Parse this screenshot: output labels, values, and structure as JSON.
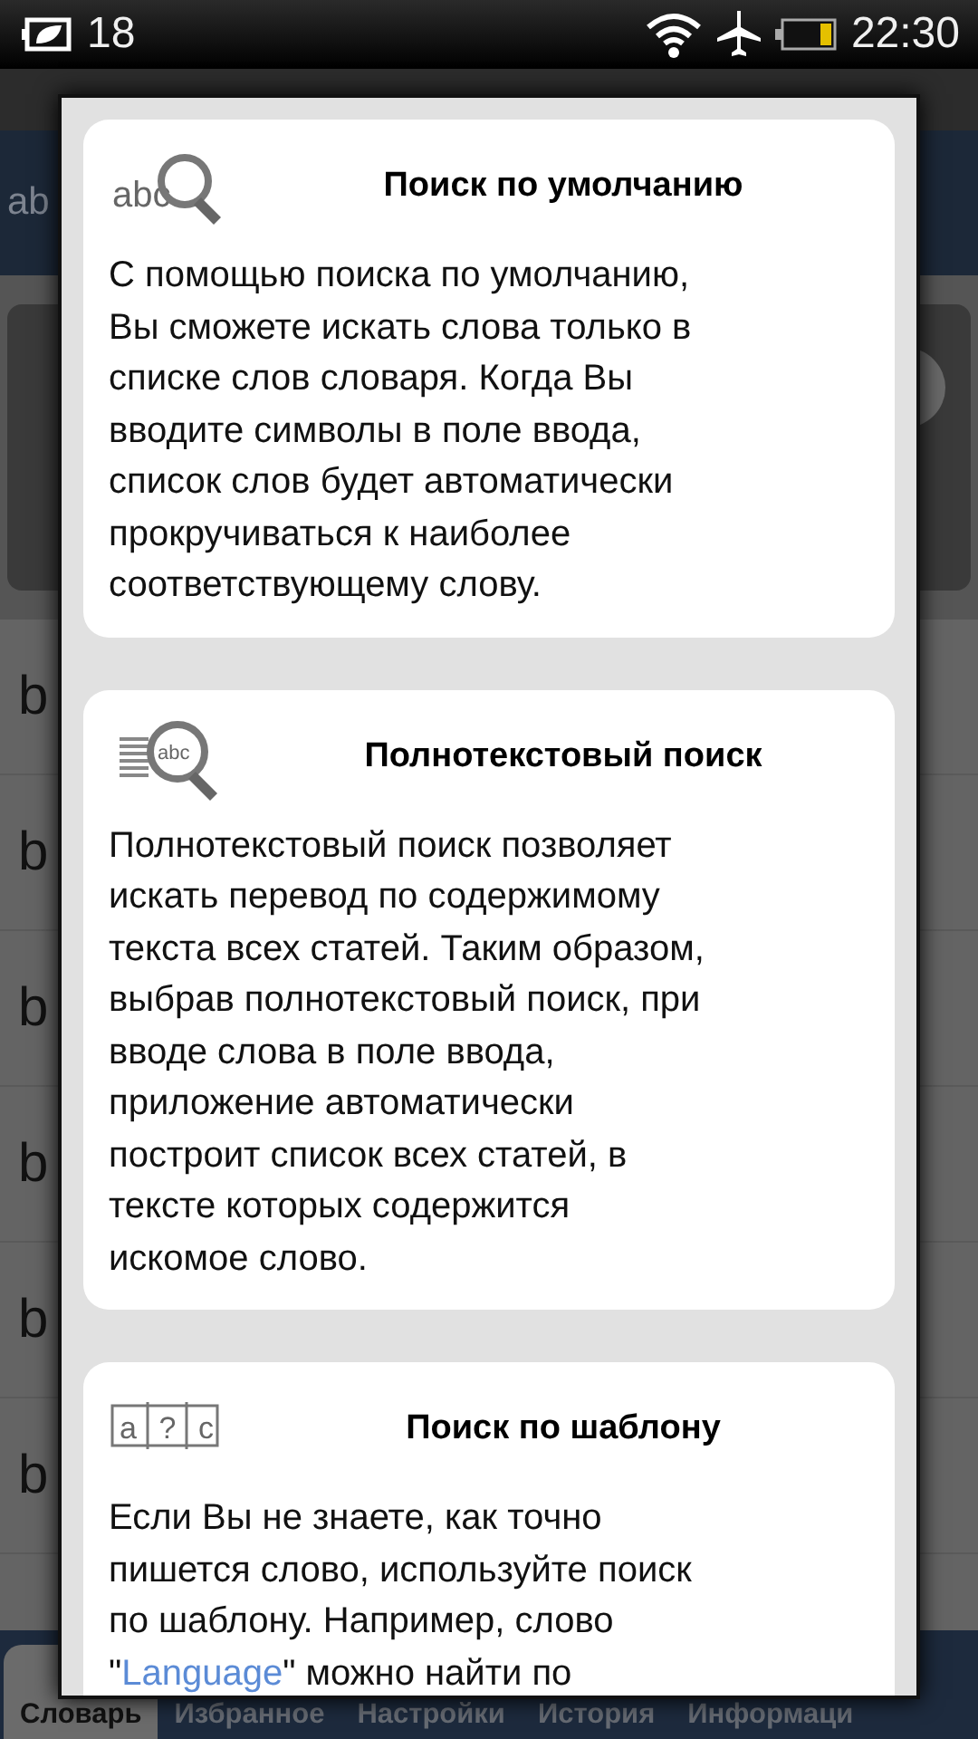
{
  "status_bar": {
    "notification_count": "18",
    "time": "22:30"
  },
  "background_app": {
    "header_text": "ab",
    "list_rows": [
      "b",
      "b",
      "b",
      "b",
      "b",
      "b"
    ],
    "tabs": [
      {
        "label": "Словарь",
        "selected": true
      },
      {
        "label": "Избранное",
        "selected": false
      },
      {
        "label": "Настройки",
        "selected": false
      },
      {
        "label": "История",
        "selected": false
      },
      {
        "label": "Информаци",
        "selected": false
      }
    ]
  },
  "dialog": {
    "cards": [
      {
        "kind": "default",
        "icon_text": "abc",
        "title": "Поиск по умолчанию",
        "body": "С помощью поиска по умолчанию,\nВы сможете искать слова только в\nсписке слов словаря. Когда Вы\nвводите символы в поле ввода,\nсписок слов будет автоматически\nпрокручиваться к наиболее\nсоответствующему слову."
      },
      {
        "kind": "fulltext",
        "icon_text": "abc",
        "title": "Полнотекстовый поиск",
        "body": "Полнотекстовый поиск позволяет\nискать перевод по содержимому\nтекста всех статей. Таким образом,\nвыбрав полнотекстовый поиск, при\nвводе слова в поле ввода,\nприложение автоматически\nпостроит список всех статей, в\nтексте которых содержится\nискомое слово."
      },
      {
        "kind": "pattern",
        "icon_text": "a?c",
        "title": "Поиск по шаблону",
        "body": "Если Вы не знаете, как точно\nпишется слово, используйте поиск\nпо шаблону. Например, слово\n\"",
        "link": "Language",
        "body_after": "\" можно найти по"
      }
    ]
  }
}
